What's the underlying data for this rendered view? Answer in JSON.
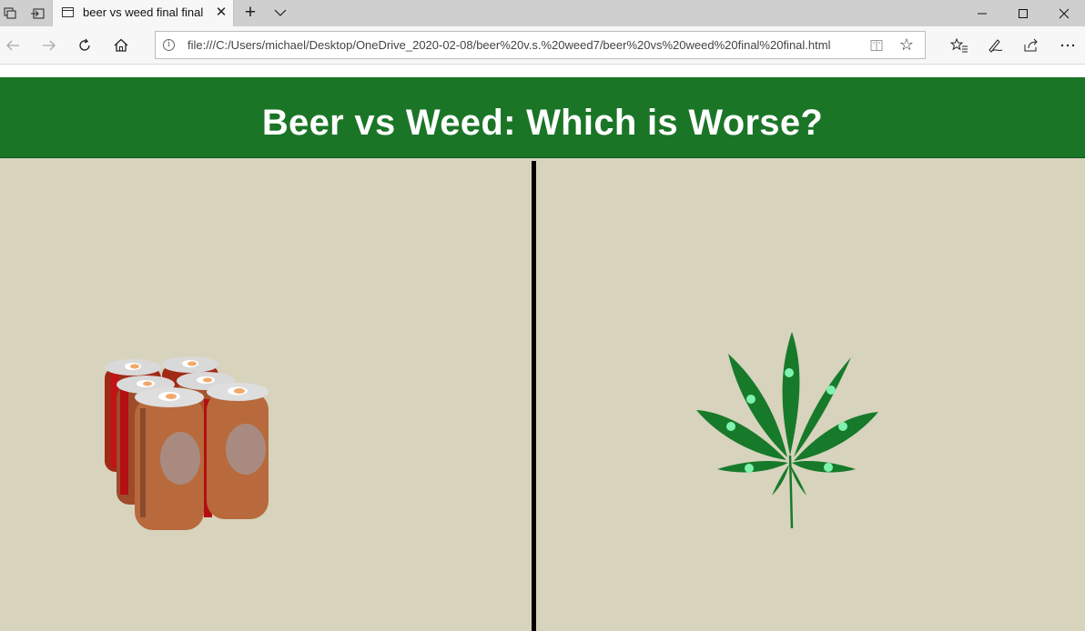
{
  "browser": {
    "tab_title": "beer vs weed final final",
    "url": "file:///C:/Users/michael/Desktop/OneDrive_2020-02-08/beer%20v.s.%20weed7/beer%20vs%20weed%20final%20final.html",
    "icons": [
      "tab-preview-icon",
      "set-aside-icon",
      "page-icon",
      "close-icon",
      "new-tab-icon",
      "chevron-down-icon",
      "minimize-icon",
      "maximize-icon",
      "close-icon",
      "back-icon",
      "forward-icon",
      "refresh-icon",
      "home-icon",
      "info-icon",
      "reading-view-icon",
      "star-icon",
      "favorites-icon",
      "pen-icon",
      "share-icon",
      "more-icon"
    ]
  },
  "page": {
    "title": "Beer vs Weed: Which is Worse?",
    "colors": {
      "banner": "#1b7527",
      "background": "#d7d3bd",
      "divider": "#000000",
      "can_body": "#b86a3c",
      "can_stripe": "#b30f12",
      "leaf": "#167a2a",
      "leaf_dots": "#7ff2b0"
    },
    "illustrations": [
      "beer-six-pack",
      "cannabis-leaf"
    ]
  }
}
